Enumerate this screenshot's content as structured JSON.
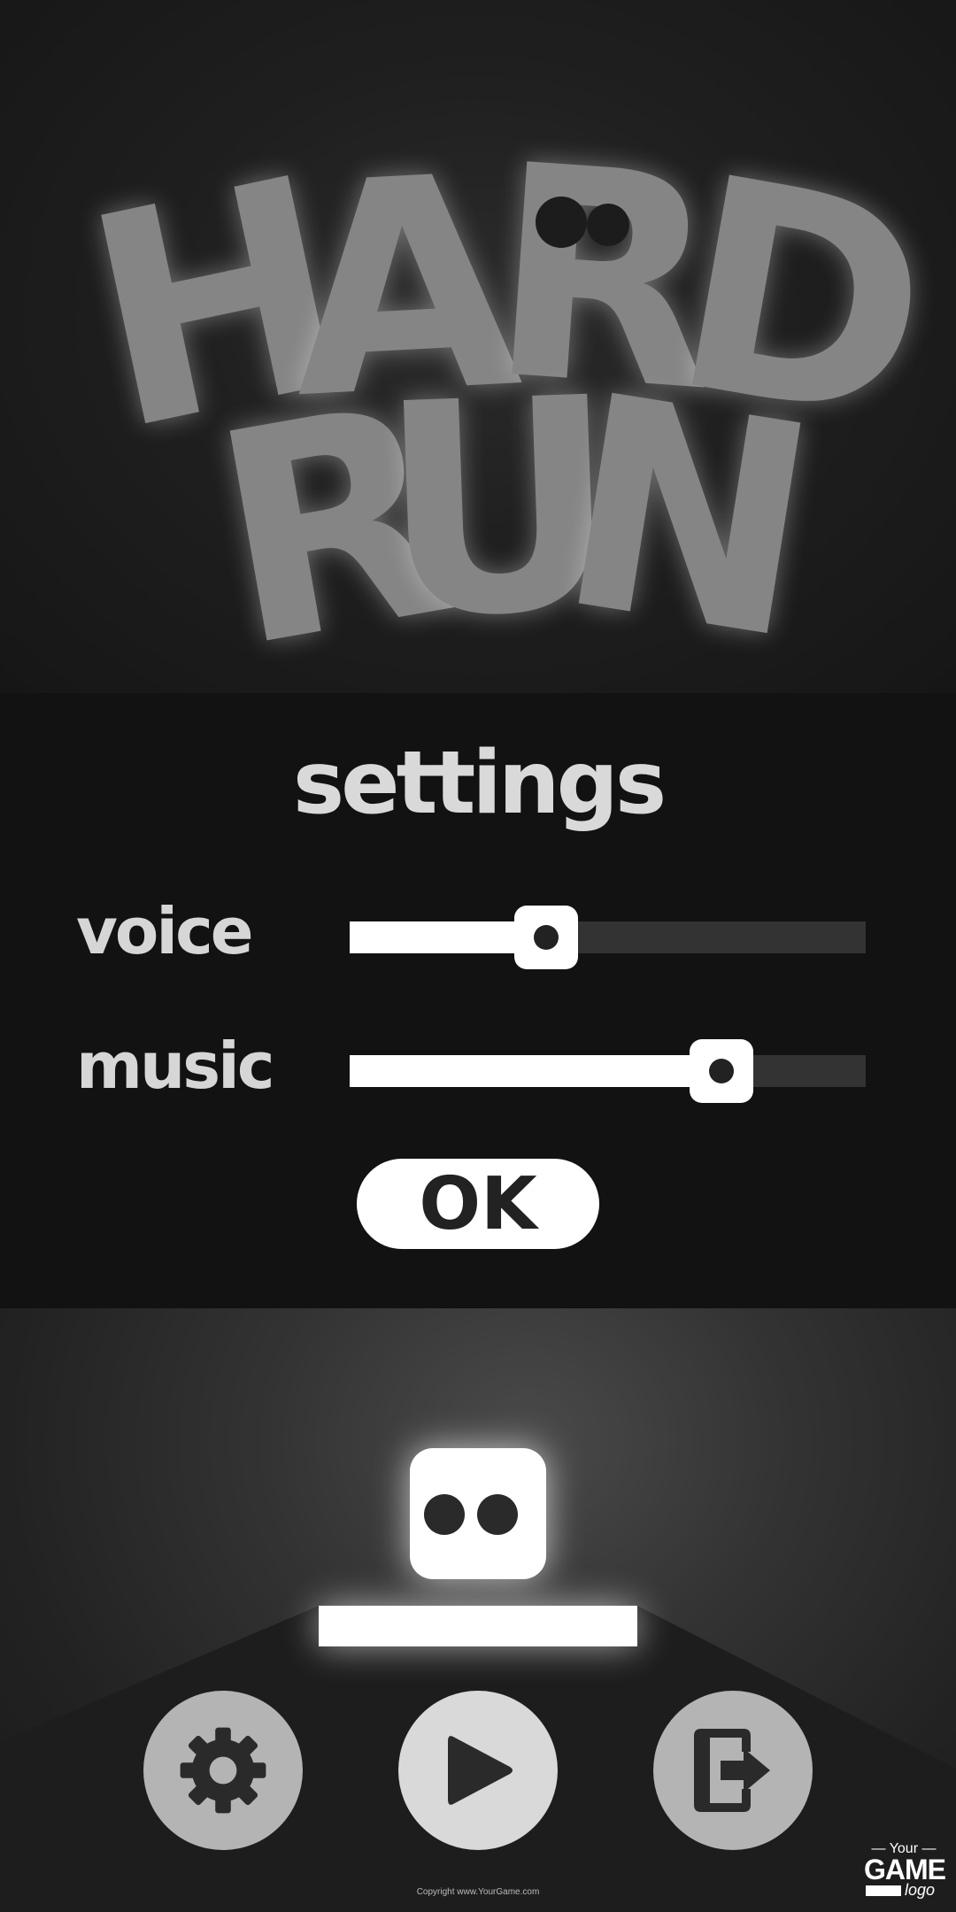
{
  "title": {
    "line1": [
      "H",
      "A",
      "R",
      "D"
    ],
    "line2": [
      "R",
      "U",
      "N"
    ]
  },
  "settings": {
    "heading": "settings",
    "voice": {
      "label": "voice",
      "level": 0.38
    },
    "music": {
      "label": "music",
      "level": 0.72
    },
    "ok_label": "OK"
  },
  "buttons": {
    "settings_icon": "gear-icon",
    "play_icon": "play-icon",
    "exit_icon": "exit-icon"
  },
  "footer": {
    "copyright": "Copyright www.YourGame.com",
    "logo_your": "— Your —",
    "logo_game": "GAME",
    "logo_word": "logo"
  },
  "colors": {
    "logo_text": "#858585",
    "accent": "#ffffff",
    "panel": "#121212"
  }
}
